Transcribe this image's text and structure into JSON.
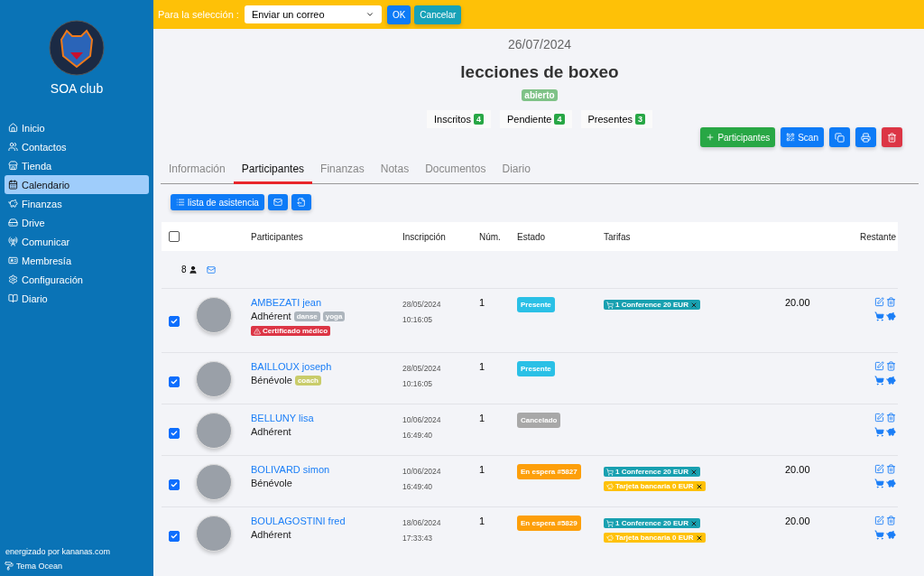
{
  "sidebar": {
    "brand": "SOA club",
    "items": [
      {
        "label": "Inicio",
        "selected": false
      },
      {
        "label": "Contactos",
        "selected": false
      },
      {
        "label": "Tienda",
        "selected": false
      },
      {
        "label": "Calendario",
        "selected": true
      },
      {
        "label": "Finanzas",
        "selected": false
      },
      {
        "label": "Drive",
        "selected": false
      },
      {
        "label": "Comunicar",
        "selected": false
      },
      {
        "label": "Membresía",
        "selected": false
      },
      {
        "label": "Configuración",
        "selected": false
      },
      {
        "label": "Diario",
        "selected": false
      }
    ],
    "footer": "energizado por kananas.com",
    "theme": "Tema Ocean"
  },
  "selection_bar": {
    "label": "Para la selección :",
    "action": "Enviar un correo",
    "buttons": [
      {
        "kind": "primary",
        "label": "OK"
      },
      {
        "kind": "info",
        "label": "Cancelar"
      }
    ]
  },
  "event": {
    "date": "26/07/2024",
    "title": "lecciones de boxeo",
    "status": "abierto",
    "counters": [
      {
        "label": "Inscritos",
        "count": "4"
      },
      {
        "label": "Pendiente",
        "count": "4"
      },
      {
        "label": "Presentes",
        "count": "3"
      }
    ]
  },
  "actions": [
    {
      "kind": "add",
      "label": "Participantes"
    },
    {
      "kind": "scan",
      "label": "Scan"
    },
    {
      "kind": "copy"
    },
    {
      "kind": "print"
    },
    {
      "kind": "delete"
    }
  ],
  "tabs": [
    {
      "label": "Información",
      "selected": false
    },
    {
      "label": "Participantes",
      "selected": true
    },
    {
      "label": "Finanzas",
      "selected": false
    },
    {
      "label": "Notas",
      "selected": false
    },
    {
      "label": "Documentos",
      "selected": false
    },
    {
      "label": "Diario",
      "selected": false
    }
  ],
  "toolbar": [
    {
      "kind": "list",
      "label": "lista de asistencia"
    },
    {
      "kind": "mail"
    },
    {
      "kind": "export"
    }
  ],
  "table": {
    "header_checked": false,
    "columns": [
      "Participantes",
      "Inscripción",
      "Núm.",
      "Estado",
      "Tarifas",
      "Restante"
    ],
    "summary_count": "8",
    "rows": [
      {
        "checked": true,
        "name": "AMBEZATI jean",
        "role": "Adhérent",
        "tags": [
          {
            "label": "danse",
            "color": "#adb5bd"
          },
          {
            "label": "yoga",
            "color": "#adb5bd"
          }
        ],
        "warning": "Certificado médico",
        "date": "28/05/2024",
        "time": "10:16:05",
        "num": "1",
        "status": {
          "kind": "present",
          "label": "Presente"
        },
        "fees": [
          {
            "kind": "cart",
            "label": "1 Conference 20 EUR"
          }
        ],
        "remaining": "20.00"
      },
      {
        "checked": true,
        "name": "BAILLOUX joseph",
        "role": "Bénévole",
        "tags": [
          {
            "label": "coach",
            "color": "#c9cc6a"
          }
        ],
        "date": "28/05/2024",
        "time": "10:16:05",
        "num": "1",
        "status": {
          "kind": "present",
          "label": "Presente"
        },
        "fees": []
      },
      {
        "checked": true,
        "name": "BELLUNY lisa",
        "role": "Adhérent",
        "tags": [],
        "date": "10/06/2024",
        "time": "16:49:40",
        "num": "1",
        "status": {
          "kind": "cancelled",
          "label": "Cancelado"
        },
        "fees": []
      },
      {
        "checked": true,
        "name": "BOLIVARD simon",
        "role": "Bénévole",
        "tags": [],
        "date": "10/06/2024",
        "time": "16:49:40",
        "num": "1",
        "status": {
          "kind": "waiting",
          "label": "En espera #5827"
        },
        "fees": [
          {
            "kind": "cart",
            "label": "1 Conference 20 EUR"
          },
          {
            "kind": "piggy",
            "label": "Tarjeta bancaria 0 EUR"
          }
        ],
        "remaining": "20.00"
      },
      {
        "checked": true,
        "name": "BOULAGOSTINI fred",
        "role": "Adhérent",
        "tags": [],
        "date": "18/06/2024",
        "time": "17:33:43",
        "num": "1",
        "status": {
          "kind": "waiting",
          "label": "En espera #5829"
        },
        "fees": [
          {
            "kind": "cart",
            "label": "1 Conference 20 EUR"
          },
          {
            "kind": "piggy",
            "label": "Tarjeta bancaria 0 EUR"
          }
        ],
        "remaining": "20.00"
      }
    ]
  }
}
